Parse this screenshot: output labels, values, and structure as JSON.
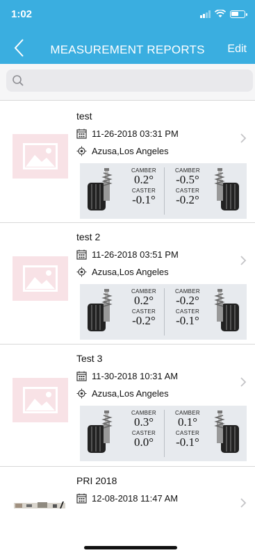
{
  "status_bar": {
    "time": "1:02"
  },
  "nav": {
    "title": "MEASUREMENT REPORTS",
    "edit_label": "Edit"
  },
  "search": {
    "placeholder": ""
  },
  "labels": {
    "camber": "CAMBER",
    "caster": "CASTER"
  },
  "reports": [
    {
      "title": "test",
      "date": "11-26-2018 03:31 PM",
      "location": "Azusa,Los Angeles",
      "left": {
        "camber": "0.2°",
        "caster": "-0.1°"
      },
      "right": {
        "camber": "-0.5°",
        "caster": "-0.2°"
      }
    },
    {
      "title": "test 2",
      "date": "11-26-2018 03:51 PM",
      "location": "Azusa,Los Angeles",
      "left": {
        "camber": "0.2°",
        "caster": "-0.2°"
      },
      "right": {
        "camber": "-0.2°",
        "caster": "-0.1°"
      }
    },
    {
      "title": "Test 3",
      "date": "11-30-2018 10:31 AM",
      "location": "Azusa,Los Angeles",
      "left": {
        "camber": "0.3°",
        "caster": "0.0°"
      },
      "right": {
        "camber": "0.1°",
        "caster": "-0.1°"
      }
    },
    {
      "title": "PRI 2018",
      "date": "12-08-2018 11:47 AM"
    }
  ],
  "colors": {
    "accent": "#3aaee0",
    "placeholder_bg": "#f8e2e6"
  }
}
